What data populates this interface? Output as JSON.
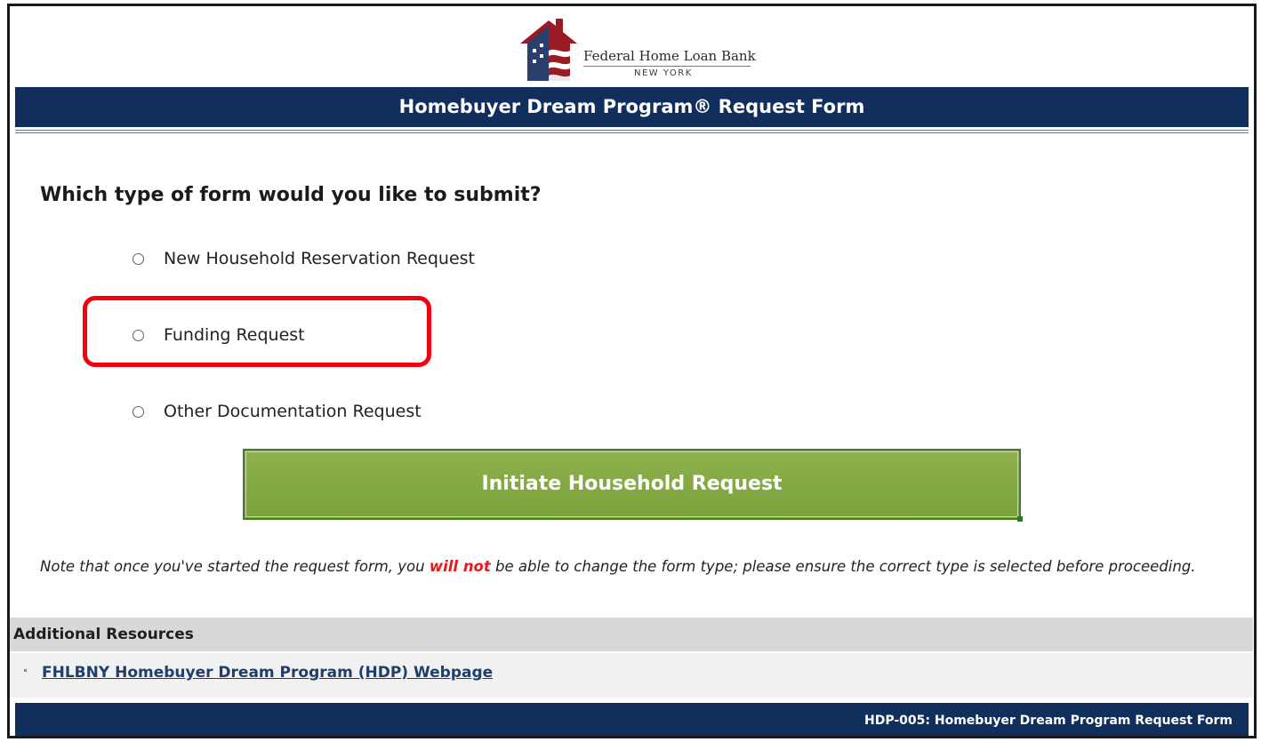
{
  "logo": {
    "name": "Federal Home Loan Bank",
    "sub": "NEW YORK",
    "icon": "house-flag-icon"
  },
  "header": {
    "title": "Homebuyer Dream Program® Request Form"
  },
  "form": {
    "question": "Which type of form would you like to submit?",
    "options": [
      {
        "label": "New Household Reservation Request",
        "selected": false
      },
      {
        "label": "Funding Request",
        "selected": false
      },
      {
        "label": "Other Documentation Request",
        "selected": false
      }
    ],
    "highlighted_option": "Funding Request",
    "button_label": "Initiate Household Request"
  },
  "note": {
    "before": "Note that once you've started the request form, you ",
    "warning": "will not",
    "after": " be able to change the form type; please ensure the correct type is selected before proceeding."
  },
  "resources": {
    "header": "Additional Resources",
    "link": "FHLBNY Homebuyer Dream Program (HDP) Webpage"
  },
  "footer": {
    "text": "HDP-005: Homebuyer Dream Program Request Form"
  },
  "colors": {
    "navy": "#102f5c",
    "button_green": "#7aa23c",
    "highlight_red": "#f2000e",
    "warning_red": "#e8191e",
    "link_blue": "#1f3e6b"
  }
}
